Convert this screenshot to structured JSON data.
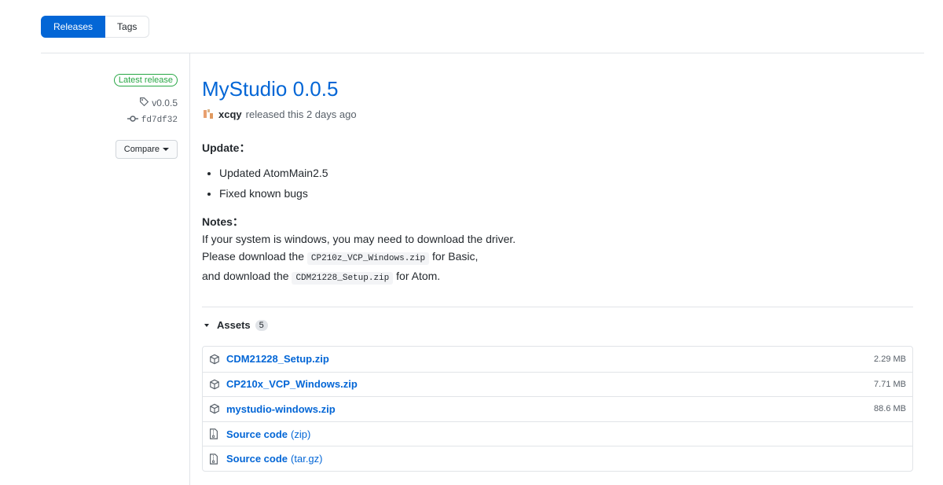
{
  "tabs": {
    "releases": "Releases",
    "tags": "Tags"
  },
  "sidebar": {
    "badge": "Latest release",
    "tag": "v0.0.5",
    "commit": "fd7df32",
    "compare": "Compare"
  },
  "release": {
    "title": "MyStudio 0.0.5",
    "author": "xcqy",
    "released_text": "released this 2 days ago"
  },
  "notes": {
    "update_heading": "Update：",
    "items": [
      "Updated AtomMain2.5",
      "Fixed known bugs"
    ],
    "notes_heading": "Notes：",
    "line1": "If your system is windows, you may need to download the driver.",
    "line2_pre": "Please download the",
    "line2_code": "CP210z_VCP_Windows.zip",
    "line2_post": "for Basic,",
    "line3_pre": "and download the",
    "line3_code": "CDM21228_Setup.zip",
    "line3_post": "for Atom."
  },
  "assets": {
    "label": "Assets",
    "count": "5",
    "rows": [
      {
        "name": "CDM21228_Setup.zip",
        "size": "2.29 MB",
        "icon": "package-icon"
      },
      {
        "name": "CP210x_VCP_Windows.zip",
        "size": "7.71 MB",
        "icon": "package-icon"
      },
      {
        "name": "mystudio-windows.zip",
        "size": "88.6 MB",
        "icon": "package-icon"
      },
      {
        "name": "Source code",
        "suffix": "(zip)",
        "icon": "file-zip-icon"
      },
      {
        "name": "Source code",
        "suffix": "(tar.gz)",
        "icon": "file-zip-icon"
      }
    ]
  },
  "colors": {
    "accent": "#0366d6",
    "badge_green": "#28a745",
    "muted": "#586069"
  }
}
